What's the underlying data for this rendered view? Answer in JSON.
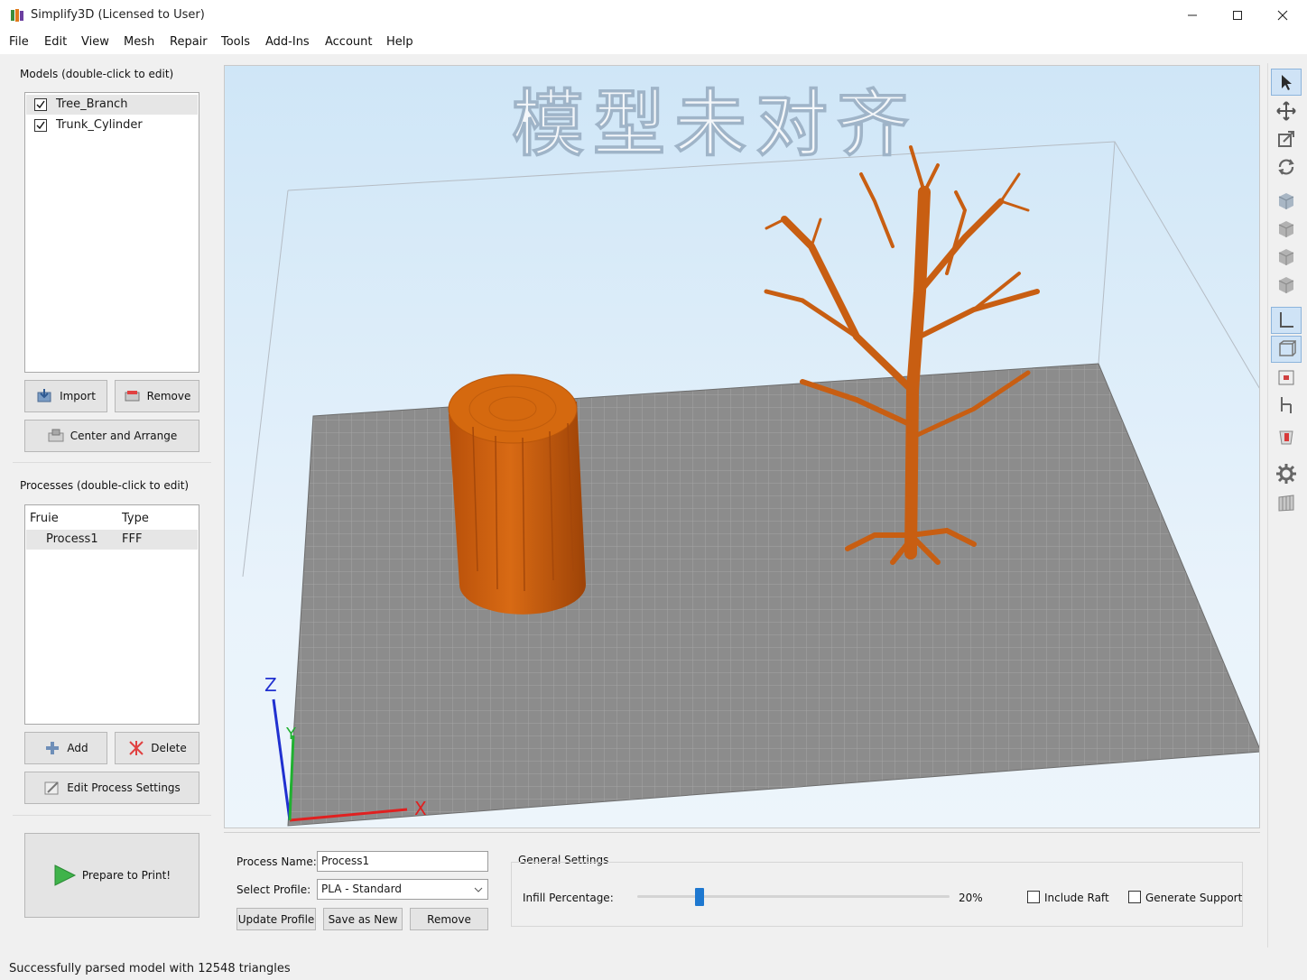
{
  "window": {
    "title": "Simplify3D (Licensed to User)",
    "controls": [
      "minimize-icon",
      "maximize-icon",
      "close-icon"
    ]
  },
  "menu": [
    "File",
    "Edit",
    "View",
    "Mesh",
    "Repair",
    "Tools",
    "Add-Ins",
    "Account",
    "Help"
  ],
  "models": {
    "label": "Models (double-click to edit)",
    "items": [
      {
        "name": "Tree_Branch",
        "checked": true
      },
      {
        "name": "Trunk_Cylinder",
        "checked": true
      }
    ],
    "import_label": "Import",
    "remove_label": "Remove",
    "center_label": "Center and Arrange"
  },
  "processes": {
    "label": "Processes (double-click to edit)",
    "columns": [
      "Fruie",
      "Type"
    ],
    "rows": [
      {
        "name": "Process1",
        "type": "FFF"
      }
    ],
    "add_label": "Add",
    "delete_label": "Delete",
    "edit_label": "Edit Process Settings"
  },
  "prepare_label": "Prepare to Print!",
  "viewport": {
    "overlay_title": "模型未对齐",
    "axis_x": "X",
    "axis_y": "Y",
    "axis_z": "Z",
    "model_color": "#cf5e0c",
    "bed_color": "#8a8a8a"
  },
  "right_toolbar": [
    "select-icon",
    "move-icon",
    "scale-icon",
    "rotate-icon",
    "view-default-icon",
    "view-front-icon",
    "view-side-icon",
    "view-top-icon",
    "axes-icon",
    "build-volume-icon",
    "cross-section-icon",
    "tool-axis-icon",
    "support-icon",
    "settings-gear-icon",
    "layer-view-icon"
  ],
  "process_panel": {
    "process_name_label": "Process Name:",
    "process_name_value": "Process1",
    "profile_label": "Select Profile:",
    "profile_value": "PLA - Standard",
    "update_label": "Update Profile",
    "save_new_label": "Save as New",
    "remove_label": "Remove",
    "general_label": "General Settings",
    "infill_label": "Infill Percentage:",
    "infill_value": "20%",
    "infill_fraction": 0.2,
    "raft_label": "Include Raft",
    "raft_checked": false,
    "support_label": "Generate Support",
    "support_checked": false
  },
  "status": "Successfully parsed model with 12548 triangles"
}
